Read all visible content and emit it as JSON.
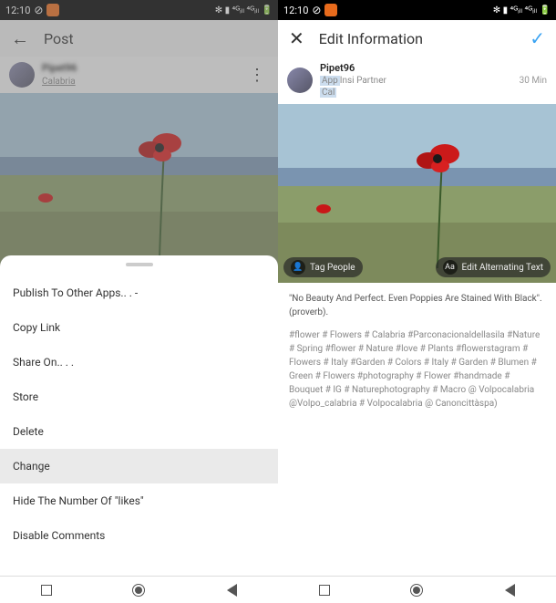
{
  "status_bar": {
    "time": "12:10",
    "icons": "✻ ▮ ⁴ᴳᵢₗₗ ⁴ᴳᵢₗₗ 🔋"
  },
  "left": {
    "header": {
      "title": "Post"
    },
    "user": {
      "name": "Pipet96",
      "location": "Calabria"
    },
    "menu": {
      "items": [
        "Publish To Other Apps.. . -",
        "Copy Link",
        "Share On.. . .",
        "Store",
        "Delete",
        "Change",
        "Hide The Number Of \"likes\"",
        "Disable Comments"
      ],
      "selected_index": 5
    }
  },
  "right": {
    "header": {
      "title": "Edit Information"
    },
    "user": {
      "name": "Pipet96",
      "badge": "App",
      "sub": "Insi Partner",
      "location": "Cal",
      "timestamp": "30 Min"
    },
    "photo_actions": {
      "tag": "Tag People",
      "alt": "Edit Alternating Text"
    },
    "caption": {
      "quote": "\"No Beauty And Perfect. Even Poppies Are Stained With Black\".(proverb).",
      "hashtags": "#flower # Flowers # Calabria #Parconacionaldellasila #Nature # Spring #flower # Nature #love # Plants #flowerstagram # Flowers # Italy #Garden # Colors # Italy # Garden # Blumen # Green # Flowers #photography # Flower #handmade # Bouquet # IG # Naturephotography # Macro @ Volpocalabria @Volpo_calabria # Volpocalabria @ Canoncittàspa)"
    }
  },
  "icons": {
    "back": "←",
    "close": "✕",
    "check": "✓",
    "more": "⋮",
    "person": "👤",
    "aa": "Aa"
  }
}
